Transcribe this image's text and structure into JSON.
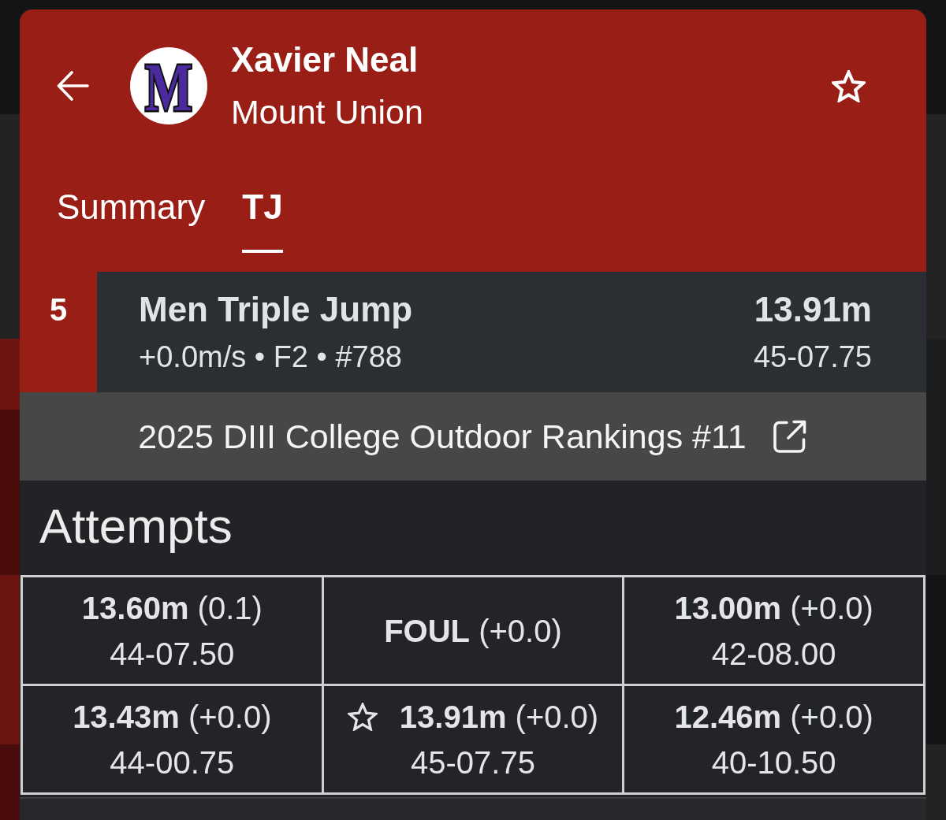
{
  "header": {
    "athlete_name": "Xavier Neal",
    "team": "Mount Union",
    "logo_text": "M",
    "favorited": false
  },
  "tabs": [
    {
      "label": "Summary",
      "selected": false
    },
    {
      "label": "TJ",
      "selected": true
    }
  ],
  "result": {
    "place": "5",
    "event": "Men Triple Jump",
    "details": "+0.0m/s • F2 • #788",
    "mark": "13.91m",
    "mark_imperial": "45-07.75"
  },
  "ranking_link": {
    "label": "2025 DIII College Outdoor Rankings #11"
  },
  "attempts": {
    "title": "Attempts",
    "items": [
      {
        "kind": "mark",
        "mark": "13.60m",
        "wind": "(0.1)",
        "imperial": "44-07.50",
        "best": false
      },
      {
        "kind": "foul",
        "mark": "FOUL",
        "wind": "(+0.0)",
        "best": false
      },
      {
        "kind": "mark",
        "mark": "13.00m",
        "wind": "(+0.0)",
        "imperial": "42-08.00",
        "best": false
      },
      {
        "kind": "mark",
        "mark": "13.43m",
        "wind": "(+0.0)",
        "imperial": "44-00.75",
        "best": false
      },
      {
        "kind": "mark",
        "mark": "13.91m",
        "wind": "(+0.0)",
        "imperial": "45-07.75",
        "best": true
      },
      {
        "kind": "mark",
        "mark": "12.46m",
        "wind": "(+0.0)",
        "imperial": "40-10.50",
        "best": false
      }
    ]
  }
}
